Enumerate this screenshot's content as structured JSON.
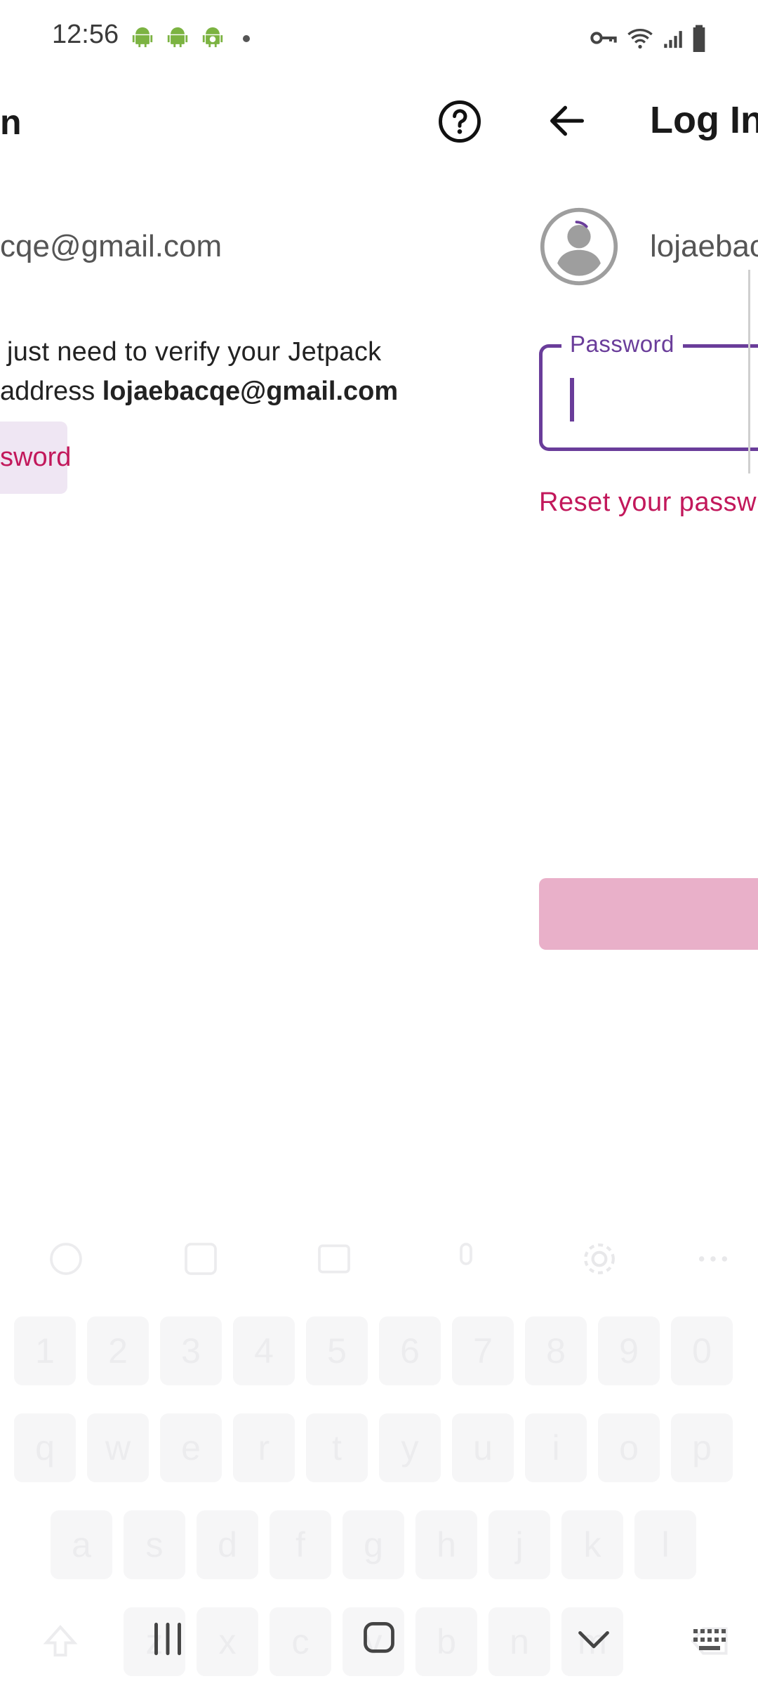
{
  "status_bar": {
    "time": "12:56",
    "left_icons": [
      "android-icon",
      "android-icon",
      "android-icon-badge"
    ],
    "right_icons": [
      "vpn-key-icon",
      "wifi-icon",
      "signal-icon",
      "battery-icon"
    ]
  },
  "left_screen": {
    "title_fragment": "n",
    "email_fragment": "cqe@gmail.com",
    "message_line1": " just need to verify your Jetpack",
    "message_line2_prefix": "address ",
    "message_line2_email": "lojaebacqe@gmail.com",
    "password_button_fragment": "sword"
  },
  "right_screen": {
    "title": "Log In",
    "email_fragment": "lojaebac",
    "password_label": "Password",
    "password_value": "",
    "reset_link": "Reset your passw"
  },
  "keyboard": {
    "number_row": [
      "1",
      "2",
      "3",
      "4",
      "5",
      "6",
      "7",
      "8",
      "9",
      "0"
    ],
    "row1": [
      "q",
      "w",
      "e",
      "r",
      "t",
      "y",
      "u",
      "i",
      "o",
      "p"
    ],
    "row2": [
      "a",
      "s",
      "d",
      "f",
      "g",
      "h",
      "j",
      "k",
      "l"
    ],
    "row3": [
      "z",
      "x",
      "c",
      "v",
      "b",
      "n",
      "m"
    ]
  },
  "colors": {
    "accent_purple": "#6a3d9a",
    "link_pink": "#c2185b",
    "button_disabled": "#e9b0c9",
    "chip_bg": "#efe6f3"
  }
}
